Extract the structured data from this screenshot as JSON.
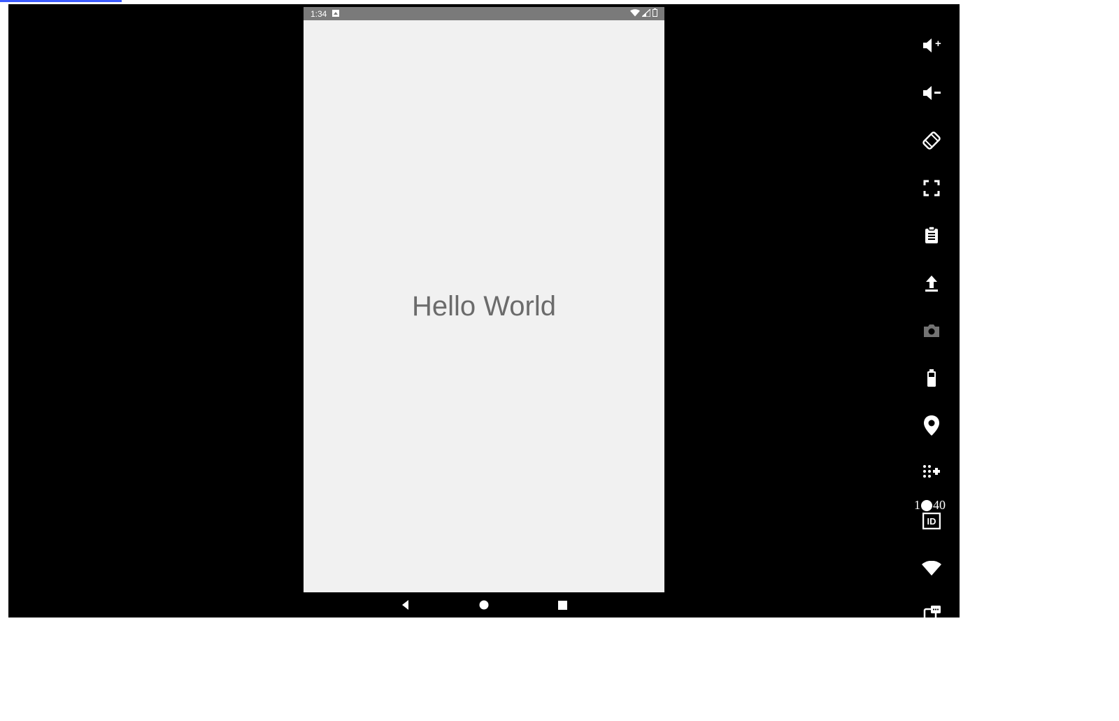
{
  "status_bar": {
    "time": "1:34",
    "debug_badge": "□",
    "wifi_icon": "wifi",
    "signal_icon": "signal",
    "battery_icon": "battery"
  },
  "app": {
    "message": "Hello World"
  },
  "nav": {
    "back": "back",
    "home": "home",
    "recents": "recents"
  },
  "emu_controls": {
    "volume_up": "volume-up",
    "volume_down": "volume-down",
    "rotate": "rotate",
    "fullscreen": "fullscreen",
    "clipboard": "clipboard",
    "upload": "upload",
    "camera": "camera",
    "battery": "battery",
    "location": "location",
    "more": "more",
    "id": "ID",
    "wifi": "wifi",
    "sms": "sms"
  },
  "slide": {
    "current_part_a": "1",
    "current_part_b": "40"
  }
}
